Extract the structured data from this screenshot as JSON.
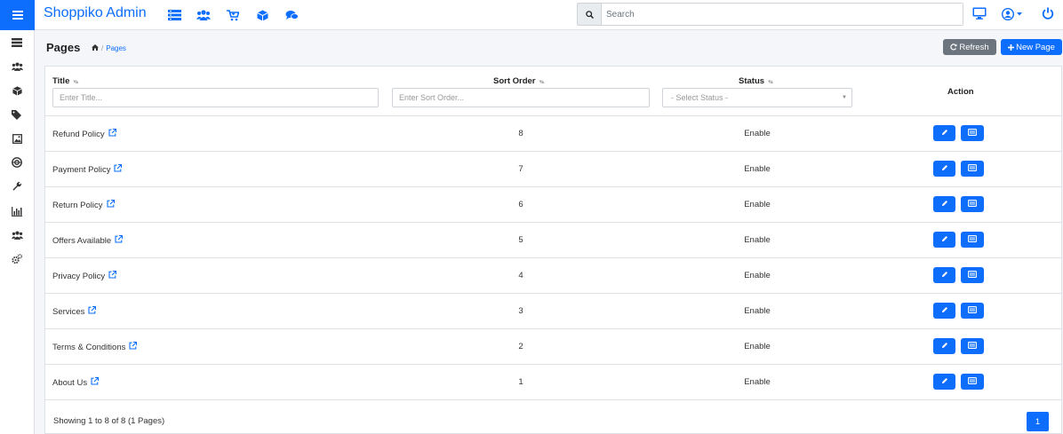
{
  "app": {
    "brand": "Shoppiko Admin"
  },
  "topnav": {
    "icons": [
      "list-icon",
      "users-icon",
      "cart-icon",
      "box-icon",
      "chat-icon"
    ]
  },
  "search": {
    "placeholder": "Search"
  },
  "sidebar": {
    "icons": [
      "list-icon",
      "users-icon",
      "box-icon",
      "tags-icon",
      "image-icon",
      "globe-icon",
      "wrench-icon",
      "chart-icon",
      "users-icon",
      "gears-icon"
    ]
  },
  "header": {
    "title": "Pages",
    "breadcrumb": "Pages",
    "refresh_label": "Refresh",
    "new_label": "New Page"
  },
  "table": {
    "columns": {
      "title": "Title",
      "sort_order": "Sort Order",
      "status": "Status",
      "action": "Action"
    },
    "filters": {
      "title_placeholder": "Enter Title...",
      "sort_placeholder": "Enter Sort Order...",
      "status_placeholder": "- Select Status -"
    },
    "rows": [
      {
        "title": "Refund Policy",
        "sort": "8",
        "status": "Enable"
      },
      {
        "title": "Payment Policy",
        "sort": "7",
        "status": "Enable"
      },
      {
        "title": "Return Policy",
        "sort": "6",
        "status": "Enable"
      },
      {
        "title": "Offers Available",
        "sort": "5",
        "status": "Enable"
      },
      {
        "title": "Privacy Policy",
        "sort": "4",
        "status": "Enable"
      },
      {
        "title": "Services",
        "sort": "3",
        "status": "Enable"
      },
      {
        "title": "Terms & Conditions",
        "sort": "2",
        "status": "Enable"
      },
      {
        "title": "About Us",
        "sort": "1",
        "status": "Enable"
      }
    ]
  },
  "footer": {
    "showing": "Showing 1 to 8 of 8 (1 Pages)",
    "page": "1"
  },
  "colors": {
    "primary": "#0d6efd",
    "secondary": "#6c757d"
  }
}
